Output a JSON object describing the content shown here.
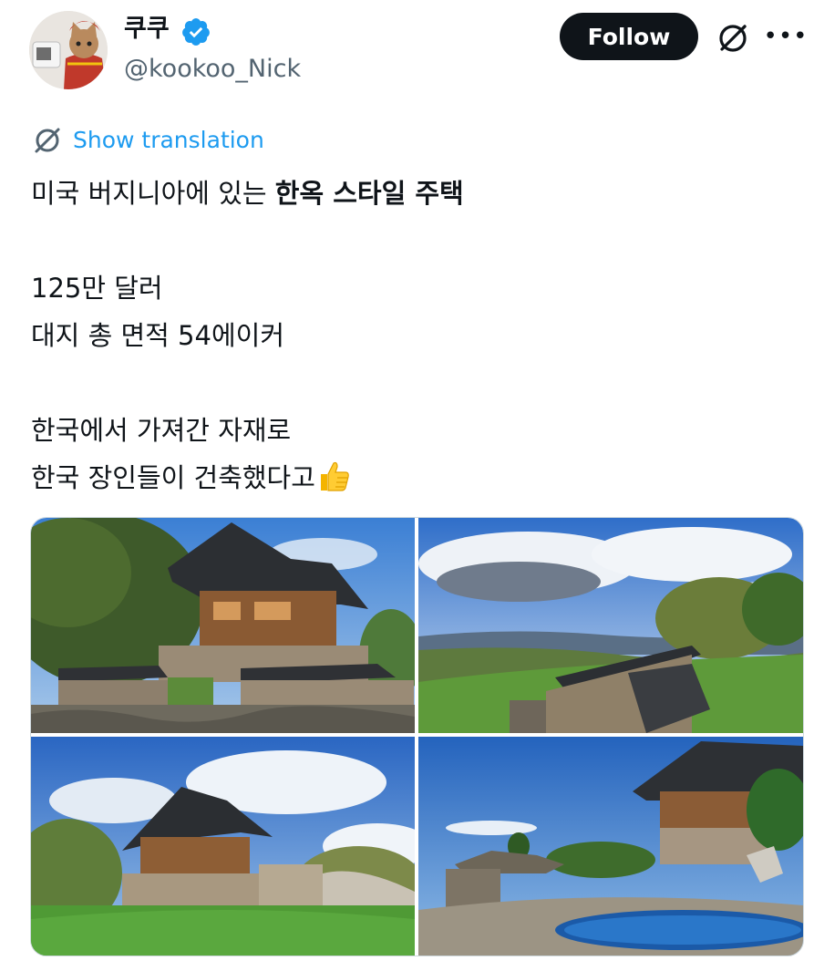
{
  "author": {
    "display_name": "쿠쿠",
    "handle": "@kookoo_Nick",
    "verified": true,
    "avatar_icon": "cat-in-red-costume-avatar"
  },
  "actions": {
    "follow_label": "Follow",
    "grok_icon": "grok-icon",
    "more_label": "•••"
  },
  "translation": {
    "label": "Show translation",
    "icon": "translate-icon"
  },
  "tweet": {
    "line1_normal": "미국 버지니아에 있는 ",
    "line1_bold": "한옥 스타일 주택",
    "line2": "125만 달러",
    "line3": "대지 총 면적 54에이커",
    "line4": "한국에서 가져간 자재로",
    "line5": "한국 장인들이 건축했다고",
    "line5_emoji": "thumbs-up-emoji"
  },
  "media": {
    "photos": [
      {
        "alt_icon": "hanok-house-photo"
      },
      {
        "alt_icon": "mountain-view-wall-photo"
      },
      {
        "alt_icon": "hanok-lawn-photo"
      },
      {
        "alt_icon": "hanok-pond-photo"
      }
    ]
  },
  "colors": {
    "accent": "#1d9bf0",
    "text": "#0f1419",
    "secondary": "#536471",
    "follow_bg": "#0f1419"
  }
}
